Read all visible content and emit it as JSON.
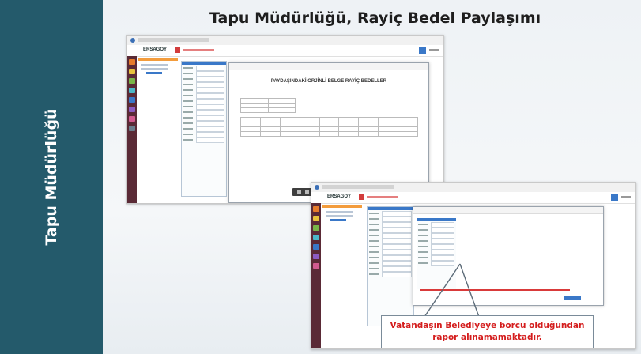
{
  "sidebar": {
    "label": "Tapu Müdürlüğü"
  },
  "slide": {
    "title": "Tapu Müdürlüğü, Rayiç Bedel Paylaşımı"
  },
  "screenshot_top": {
    "app_name": "ERSAGOY",
    "report_heading": "PAYDAŞINDAKİ ORJİNLİ BELGE RAYİÇ BEDELLER"
  },
  "screenshot_bottom": {
    "app_name": "ERSAGOY"
  },
  "callout": {
    "line1": "Vatandaşın  Belediyeye borcu olduğundan",
    "line2": "rapor alınamamaktadır."
  },
  "colors": {
    "sidebar_bg": "#245a6b",
    "callout_text": "#d41d1d",
    "accent_blue": "#3a78c8",
    "accent_orange": "#f39c3c"
  }
}
